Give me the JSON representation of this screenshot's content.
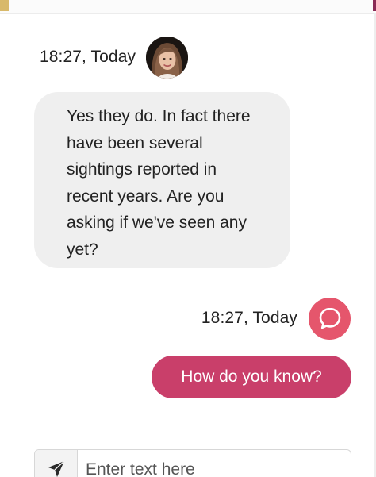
{
  "conversation": {
    "messages": [
      {
        "direction": "incoming",
        "time": "18:27, Today",
        "avatar_icon": "woman-profile-photo",
        "text": "Yes they do. In fact there have been several sightings reported in recent years. Are you asking if we've seen any yet?"
      },
      {
        "direction": "outgoing",
        "time": "18:27, Today",
        "avatar_icon": "speech-bubble-logo-icon",
        "text": "How do you know?"
      }
    ]
  },
  "composer": {
    "placeholder": "Enter text here",
    "send_icon": "paper-plane-icon"
  },
  "colors": {
    "incoming_bubble": "#efefef",
    "outgoing_bubble": "#c93f6a",
    "brand_avatar": "#e5566c",
    "text": "#222222"
  }
}
